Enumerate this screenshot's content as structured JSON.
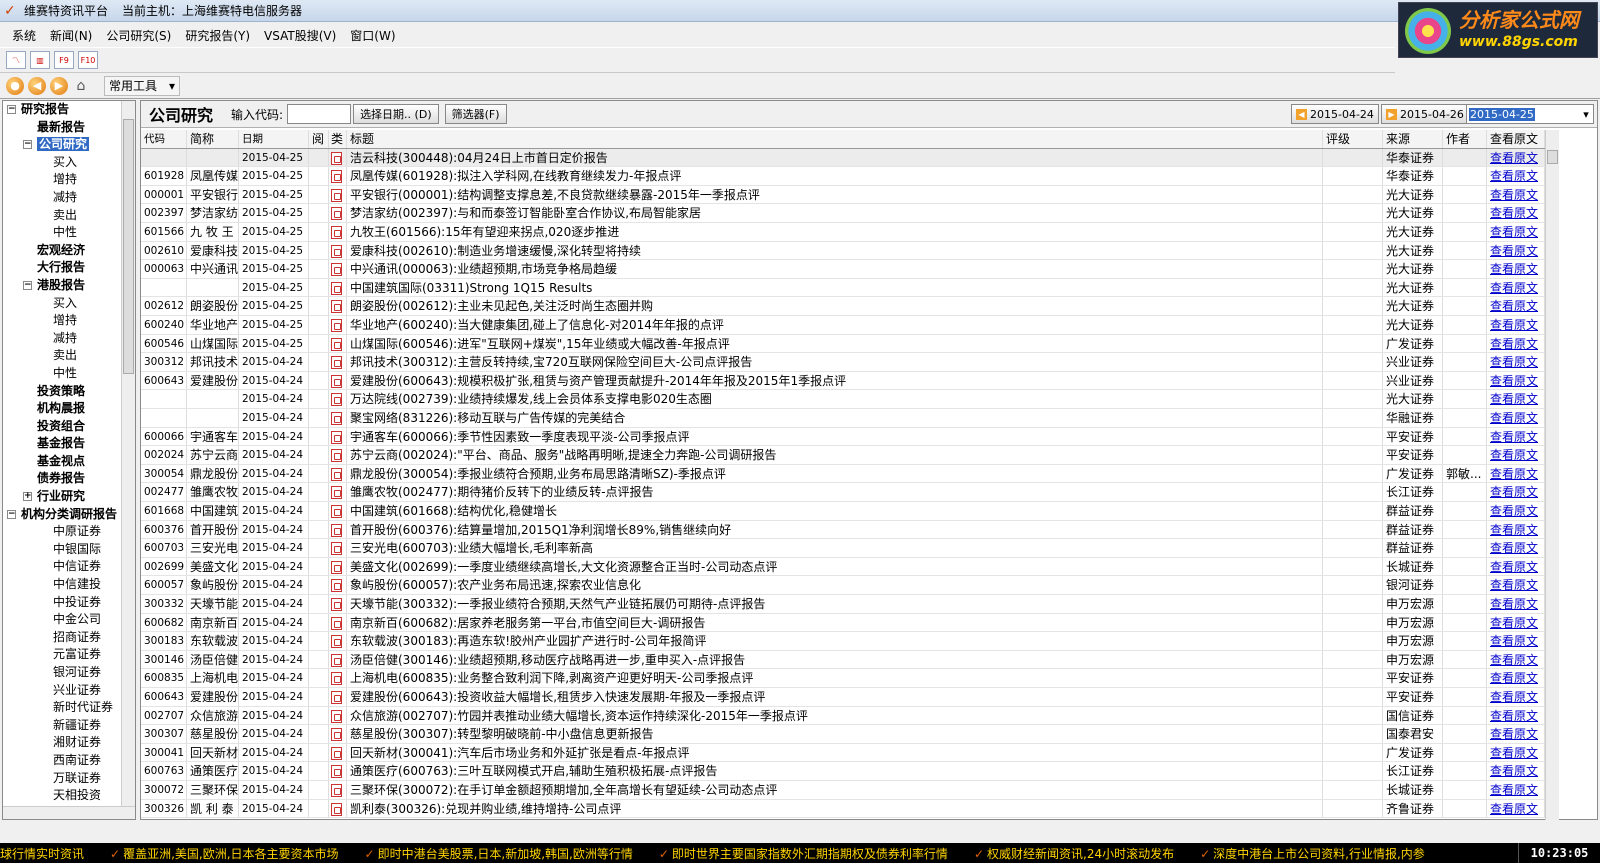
{
  "window": {
    "title": "维赛特资讯平台",
    "host_label": "当前主机：上海维赛特电信服务器"
  },
  "logo": {
    "line1": "分析家公式网",
    "line2": "www.88gs.com"
  },
  "menu": [
    "系统",
    "新闻(N)",
    "公司研究(S)",
    "研究报告(Y)",
    "VSAT股搜(V)",
    "窗口(W)"
  ],
  "toolbar": {
    "buttons": [
      "chart-icon",
      "bar-chart-icon",
      "F9",
      "F10"
    ],
    "common_tools": "常用工具"
  },
  "tree": [
    {
      "label": "研究报告",
      "level": 0,
      "toggle": "−",
      "bold": true
    },
    {
      "label": "最新报告",
      "level": 1,
      "bold": true
    },
    {
      "label": "公司研究",
      "level": 1,
      "toggle": "−",
      "bold": true,
      "selected": true
    },
    {
      "label": "买入",
      "level": 2
    },
    {
      "label": "增持",
      "level": 2
    },
    {
      "label": "减持",
      "level": 2
    },
    {
      "label": "卖出",
      "level": 2
    },
    {
      "label": "中性",
      "level": 2
    },
    {
      "label": "宏观经济",
      "level": 1,
      "bold": true
    },
    {
      "label": "大行报告",
      "level": 1,
      "bold": true
    },
    {
      "label": "港股报告",
      "level": 1,
      "toggle": "−",
      "bold": true
    },
    {
      "label": "买入",
      "level": 2
    },
    {
      "label": "增持",
      "level": 2
    },
    {
      "label": "减持",
      "level": 2
    },
    {
      "label": "卖出",
      "level": 2
    },
    {
      "label": "中性",
      "level": 2
    },
    {
      "label": "投资策略",
      "level": 1,
      "bold": true
    },
    {
      "label": "机构晨报",
      "level": 1,
      "bold": true
    },
    {
      "label": "投资组合",
      "level": 1,
      "bold": true
    },
    {
      "label": "基金报告",
      "level": 1,
      "bold": true
    },
    {
      "label": "基金视点",
      "level": 1,
      "bold": true
    },
    {
      "label": "债券报告",
      "level": 1,
      "bold": true
    },
    {
      "label": "行业研究",
      "level": 1,
      "toggle": "+",
      "bold": true
    },
    {
      "label": "机构分类调研报告",
      "level": 0,
      "toggle": "−",
      "bold": true
    },
    {
      "label": "中原证券",
      "level": 2
    },
    {
      "label": "中银国际",
      "level": 2
    },
    {
      "label": "中信证券",
      "level": 2
    },
    {
      "label": "中信建投",
      "level": 2
    },
    {
      "label": "中投证券",
      "level": 2
    },
    {
      "label": "中金公司",
      "level": 2
    },
    {
      "label": "招商证券",
      "level": 2
    },
    {
      "label": "元富证券",
      "level": 2
    },
    {
      "label": "银河证券",
      "level": 2
    },
    {
      "label": "兴业证券",
      "level": 2
    },
    {
      "label": "新时代证券",
      "level": 2
    },
    {
      "label": "新疆证券",
      "level": 2
    },
    {
      "label": "湘财证券",
      "level": 2
    },
    {
      "label": "西南证券",
      "level": 2
    },
    {
      "label": "万联证券",
      "level": 2
    },
    {
      "label": "天相投资",
      "level": 2
    }
  ],
  "panel": {
    "title": "公司研究",
    "code_label": "输入代码:",
    "code_value": "",
    "select_date": "选择日期.. (D)",
    "filter": "筛选器(F)",
    "date_prev": "2015-04-24",
    "date_next": "2015-04-26",
    "date_current": "2015-04-25"
  },
  "columns": [
    "代码",
    "简称",
    "日期",
    "阅",
    "类",
    "标题",
    "评级",
    "来源",
    "作者",
    "查看原文"
  ],
  "rows": [
    [
      "",
      "",
      "2015-04-25",
      "",
      "",
      "洁云科技(300448):04月24日上市首日定价报告",
      "",
      "华泰证券",
      "",
      "查看原文"
    ],
    [
      "601928",
      "凤凰传媒",
      "2015-04-25",
      "",
      "",
      "凤凰传媒(601928):拟注入学科网,在线教育继续发力-年报点评",
      "",
      "华泰证券",
      "",
      "查看原文"
    ],
    [
      "000001",
      "平安银行",
      "2015-04-25",
      "",
      "",
      "平安银行(000001):结构调整支撑息差,不良贷款继续暴露-2015年一季报点评",
      "",
      "光大证券",
      "",
      "查看原文"
    ],
    [
      "002397",
      "梦洁家纺",
      "2015-04-25",
      "",
      "",
      "梦洁家纺(002397):与和而泰签订智能卧室合作协议,布局智能家居",
      "",
      "光大证券",
      "",
      "查看原文"
    ],
    [
      "601566",
      "九 牧 王",
      "2015-04-25",
      "",
      "",
      "九牧王(601566):15年有望迎来拐点,020逐步推进",
      "",
      "光大证券",
      "",
      "查看原文"
    ],
    [
      "002610",
      "爱康科技",
      "2015-04-25",
      "",
      "",
      "爱康科技(002610):制造业务增速缓慢,深化转型将持续",
      "",
      "光大证券",
      "",
      "查看原文"
    ],
    [
      "000063",
      "中兴通讯",
      "2015-04-25",
      "",
      "",
      "中兴通讯(000063):业绩超预期,市场竞争格局趋缓",
      "",
      "光大证券",
      "",
      "查看原文"
    ],
    [
      "",
      "",
      "2015-04-25",
      "",
      "",
      "中国建筑国际(03311)Strong 1Q15 Results",
      "",
      "光大证券",
      "",
      "查看原文"
    ],
    [
      "002612",
      "朗姿股份",
      "2015-04-25",
      "",
      "",
      "朗姿股份(002612):主业未见起色,关注泛时尚生态圈并购",
      "",
      "光大证券",
      "",
      "查看原文"
    ],
    [
      "600240",
      "华业地产",
      "2015-04-25",
      "",
      "",
      "华业地产(600240):当大健康集团,碰上了信息化-对2014年年报的点评",
      "",
      "光大证券",
      "",
      "查看原文"
    ],
    [
      "600546",
      "山煤国际",
      "2015-04-25",
      "",
      "",
      "山煤国际(600546):进军\"互联网+煤炭\",15年业绩或大幅改善-年报点评",
      "",
      "广发证券",
      "",
      "查看原文"
    ],
    [
      "300312",
      "邦讯技术",
      "2015-04-24",
      "",
      "",
      "邦讯技术(300312):主营反转持续,宝720互联网保险空间巨大-公司点评报告",
      "",
      "兴业证券",
      "",
      "查看原文"
    ],
    [
      "600643",
      "爱建股份",
      "2015-04-24",
      "",
      "",
      "爱建股份(600643):规模积极扩张,租赁与资产管理贡献提升-2014年年报及2015年1季报点评",
      "",
      "兴业证券",
      "",
      "查看原文"
    ],
    [
      "",
      "",
      "2015-04-24",
      "",
      "",
      "万达院线(002739):业绩持续爆发,线上会员体系支撑电影020生态圈",
      "",
      "光大证券",
      "",
      "查看原文"
    ],
    [
      "",
      "",
      "2015-04-24",
      "",
      "",
      "聚宝网络(831226):移动互联与广告传媒的完美结合",
      "",
      "华融证券",
      "",
      "查看原文"
    ],
    [
      "600066",
      "宇通客车",
      "2015-04-24",
      "",
      "",
      "宇通客车(600066):季节性因素致一季度表现平淡-公司季报点评",
      "",
      "平安证券",
      "",
      "查看原文"
    ],
    [
      "002024",
      "苏宁云商",
      "2015-04-24",
      "",
      "",
      "苏宁云商(002024):\"平台、商品、服务\"战略再明晰,提速全力奔跑-公司调研报告",
      "",
      "平安证券",
      "",
      "查看原文"
    ],
    [
      "300054",
      "鼎龙股份",
      "2015-04-24",
      "",
      "",
      "鼎龙股份(300054):季报业绩符合预期,业务布局思路清晰SZ)-季报点评",
      "",
      "广发证券",
      "郭敏...",
      "查看原文"
    ],
    [
      "002477",
      "雏鹰农牧",
      "2015-04-24",
      "",
      "",
      "雏鹰农牧(002477):期待猪价反转下的业绩反转-点评报告",
      "",
      "长江证券",
      "",
      "查看原文"
    ],
    [
      "601668",
      "中国建筑",
      "2015-04-24",
      "",
      "",
      "中国建筑(601668):结构优化,稳健增长",
      "",
      "群益证券",
      "",
      "查看原文"
    ],
    [
      "600376",
      "首开股份",
      "2015-04-24",
      "",
      "",
      "首开股份(600376):结算量增加,2015Q1净利润增长89%,销售继续向好",
      "",
      "群益证券",
      "",
      "查看原文"
    ],
    [
      "600703",
      "三安光电",
      "2015-04-24",
      "",
      "",
      "三安光电(600703):业绩大幅增长,毛利率新高",
      "",
      "群益证券",
      "",
      "查看原文"
    ],
    [
      "002699",
      "美盛文化",
      "2015-04-24",
      "",
      "",
      "美盛文化(002699):一季度业绩继续高增长,大文化资源整合正当时-公司动态点评",
      "",
      "长城证券",
      "",
      "查看原文"
    ],
    [
      "600057",
      "象屿股份",
      "2015-04-24",
      "",
      "",
      "象屿股份(600057):农产业务布局迅速,探索农业信息化",
      "",
      "银河证券",
      "",
      "查看原文"
    ],
    [
      "300332",
      "天壕节能",
      "2015-04-24",
      "",
      "",
      "天壕节能(300332):一季报业绩符合预期,天然气产业链拓展仍可期待-点评报告",
      "",
      "申万宏源",
      "",
      "查看原文"
    ],
    [
      "600682",
      "南京新百",
      "2015-04-24",
      "",
      "",
      "南京新百(600682):居家养老服务第一平台,市值空间巨大-调研报告",
      "",
      "申万宏源",
      "",
      "查看原文"
    ],
    [
      "300183",
      "东软载波",
      "2015-04-24",
      "",
      "",
      "东软载波(300183):再造东软!胶州产业园扩产进行时-公司年报简评",
      "",
      "申万宏源",
      "",
      "查看原文"
    ],
    [
      "300146",
      "汤臣倍健",
      "2015-04-24",
      "",
      "",
      "汤臣倍健(300146):业绩超预期,移动医疗战略再进一步,重申买入-点评报告",
      "",
      "申万宏源",
      "",
      "查看原文"
    ],
    [
      "600835",
      "上海机电",
      "2015-04-24",
      "",
      "",
      "上海机电(600835):业务整合致利润下降,剥离资产迎更好明天-公司季报点评",
      "",
      "平安证券",
      "",
      "查看原文"
    ],
    [
      "600643",
      "爱建股份",
      "2015-04-24",
      "",
      "",
      "爱建股份(600643):投资收益大幅增长,租赁步入快速发展期-年报及一季报点评",
      "",
      "平安证券",
      "",
      "查看原文"
    ],
    [
      "002707",
      "众信旅游",
      "2015-04-24",
      "",
      "",
      "众信旅游(002707):竹园并表推动业绩大幅增长,资本运作持续深化-2015年一季报点评",
      "",
      "国信证券",
      "",
      "查看原文"
    ],
    [
      "300307",
      "慈星股份",
      "2015-04-24",
      "",
      "",
      "慈星股份(300307):转型黎明破晓前-中小盘信息更新报告",
      "",
      "国泰君安",
      "",
      "查看原文"
    ],
    [
      "300041",
      "回天新材",
      "2015-04-24",
      "",
      "",
      "回天新材(300041):汽车后市场业务和外延扩张是看点-年报点评",
      "",
      "广发证券",
      "",
      "查看原文"
    ],
    [
      "600763",
      "通策医疗",
      "2015-04-24",
      "",
      "",
      "通策医疗(600763):三叶互联网模式开启,辅助生殖积极拓展-点评报告",
      "",
      "长江证券",
      "",
      "查看原文"
    ],
    [
      "300072",
      "三聚环保",
      "2015-04-24",
      "",
      "",
      "三聚环保(300072):在手订单金额超预期增加,全年高增长有望延续-公司动态点评",
      "",
      "长城证券",
      "",
      "查看原文"
    ],
    [
      "300326",
      "凯 利 泰",
      "2015-04-24",
      "",
      "",
      "凯利泰(300326):兑现并购业绩,维持增持-公司点评",
      "",
      "齐鲁证券",
      "",
      "查看原文"
    ]
  ],
  "ticker": [
    "球行情实时资讯",
    "覆盖亚洲,美国,欧洲,日本各主要资本市场",
    "即时中港台美股票,日本,新加坡,韩国,欧洲等行情",
    "即时世界主要国家指数外汇期指期权及债券利率行情",
    "权威财经新闻资讯,24小时滚动发布",
    "深度中港台上市公司资料,行业情报,内参"
  ],
  "clock": "10:23:05"
}
